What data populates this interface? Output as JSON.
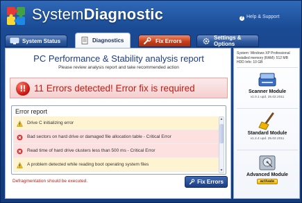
{
  "app": {
    "title_part1": "System",
    "title_part2": "Diagnostic",
    "help_link": "Help & Support"
  },
  "tabs": [
    {
      "label": "System Status",
      "icon": "monitor-icon",
      "active": false
    },
    {
      "label": "Diagnostics",
      "icon": "document-icon",
      "active": true
    },
    {
      "label": "Fix Errors",
      "icon": "wrench-icon",
      "active": false
    },
    {
      "label": "Settings & Options",
      "icon": "gear-icon",
      "active": false
    }
  ],
  "report": {
    "title": "PC Performance & Stability analysis report",
    "subtitle": "Please review analysis report and take recommended action",
    "alert_count": "11",
    "alert_text": "11 Errors detected! Error fix is required",
    "error_box_title": "Error report",
    "errors": [
      {
        "text": "Drive C initializing error",
        "severity": "warning",
        "icon": "warning-triangle-icon"
      },
      {
        "text": "Bad sectors on hard drive or damaged file allocation table - Critical Error",
        "severity": "critical",
        "icon": "critical-error-icon"
      },
      {
        "text": "Read time of hard drive clusters less than 500 ms - Critical Error",
        "severity": "critical",
        "icon": "critical-error-icon"
      },
      {
        "text": "A problem detected while reading boot operating system files",
        "severity": "warning",
        "icon": "warning-triangle-icon"
      }
    ],
    "defrag_note": "Defragmentation should be executed.",
    "fix_button": "Fix Errors"
  },
  "sidebar": {
    "sysinfo": [
      "System: Windows XP Professional",
      "Installed memory (RAM): 512 MB",
      "HDD Info: 10 GB"
    ],
    "modules": [
      {
        "name": "Scanner Module",
        "version": "v1.0.1 upd. 25.02.2011",
        "icon": "scanner-icon"
      },
      {
        "name": "Standard Module",
        "version": "v1.2.4 upd. 25.02.2011",
        "icon": "broom-icon"
      },
      {
        "name": "Advanced Module",
        "activate_label": "activate",
        "icon": "hard-drive-icon"
      }
    ]
  },
  "colors": {
    "window_blue": "#1a4a93",
    "alert_red": "#c41a12",
    "report_title_blue": "#1f3c86",
    "warning_row": "#fff4d2",
    "critical_row": "#fde0e0"
  }
}
